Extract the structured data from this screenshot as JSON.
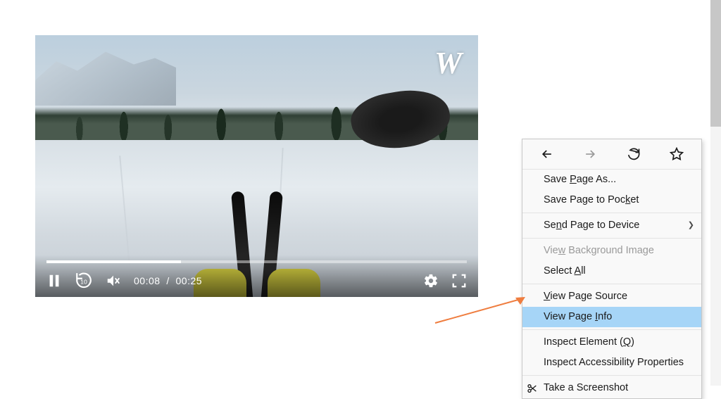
{
  "video": {
    "current_time": "00:08",
    "duration": "00:25",
    "progress_percent": 32,
    "watermark": "W"
  },
  "context_menu": {
    "save_page_as": "Save Page As...",
    "save_to_pocket": "Save Page to Pocket",
    "send_to_device": "Send Page to Device",
    "view_bg_image": "View Background Image",
    "select_all": "Select All",
    "view_source": "View Page Source",
    "view_info": "View Page Info",
    "inspect_element": "Inspect Element (Q)",
    "inspect_a11y": "Inspect Accessibility Properties",
    "screenshot": "Take a Screenshot"
  }
}
